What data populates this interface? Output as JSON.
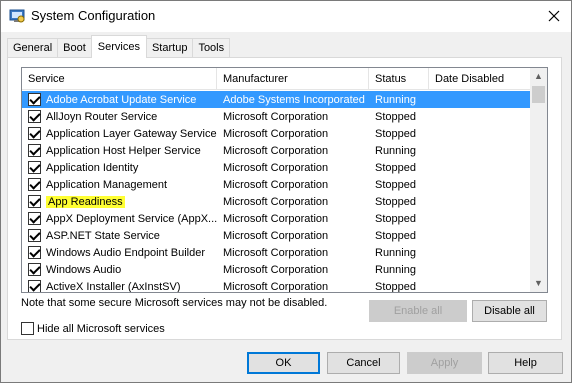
{
  "window": {
    "title": "System Configuration"
  },
  "tabs": [
    {
      "label": "General"
    },
    {
      "label": "Boot"
    },
    {
      "label": "Services"
    },
    {
      "label": "Startup"
    },
    {
      "label": "Tools"
    }
  ],
  "active_tab": "Services",
  "columns": {
    "service": "Service",
    "manufacturer": "Manufacturer",
    "status": "Status",
    "date_disabled": "Date Disabled"
  },
  "services": [
    {
      "name": "Adobe Acrobat Update Service",
      "manufacturer": "Adobe Systems Incorporated",
      "status": "Running",
      "date_disabled": "",
      "checked": true
    },
    {
      "name": "AllJoyn Router Service",
      "manufacturer": "Microsoft Corporation",
      "status": "Stopped",
      "date_disabled": "",
      "checked": true
    },
    {
      "name": "Application Layer Gateway Service",
      "manufacturer": "Microsoft Corporation",
      "status": "Stopped",
      "date_disabled": "",
      "checked": true
    },
    {
      "name": "Application Host Helper Service",
      "manufacturer": "Microsoft Corporation",
      "status": "Running",
      "date_disabled": "",
      "checked": true
    },
    {
      "name": "Application Identity",
      "manufacturer": "Microsoft Corporation",
      "status": "Stopped",
      "date_disabled": "",
      "checked": true
    },
    {
      "name": "Application Management",
      "manufacturer": "Microsoft Corporation",
      "status": "Stopped",
      "date_disabled": "",
      "checked": true
    },
    {
      "name": "App Readiness",
      "manufacturer": "Microsoft Corporation",
      "status": "Stopped",
      "date_disabled": "",
      "checked": true
    },
    {
      "name": "AppX Deployment Service (AppX...",
      "manufacturer": "Microsoft Corporation",
      "status": "Stopped",
      "date_disabled": "",
      "checked": true
    },
    {
      "name": "ASP.NET State Service",
      "manufacturer": "Microsoft Corporation",
      "status": "Stopped",
      "date_disabled": "",
      "checked": true
    },
    {
      "name": "Windows Audio Endpoint Builder",
      "manufacturer": "Microsoft Corporation",
      "status": "Running",
      "date_disabled": "",
      "checked": true
    },
    {
      "name": "Windows Audio",
      "manufacturer": "Microsoft Corporation",
      "status": "Running",
      "date_disabled": "",
      "checked": true
    },
    {
      "name": "ActiveX Installer (AxInstSV)",
      "manufacturer": "Microsoft Corporation",
      "status": "Stopped",
      "date_disabled": "",
      "checked": true
    }
  ],
  "selected_index": 0,
  "highlighted_index": 6,
  "note": "Note that some secure Microsoft services may not be disabled.",
  "buttons": {
    "enable_all": "Enable all",
    "disable_all": "Disable all",
    "ok": "OK",
    "cancel": "Cancel",
    "apply": "Apply",
    "help": "Help"
  },
  "hide_microsoft": {
    "label": "Hide all Microsoft services",
    "checked": false
  },
  "colors": {
    "selection": "#3399ff",
    "highlight": "#ffff33",
    "default_button_border": "#0078d7"
  },
  "icons": {
    "app": "system-configuration-icon",
    "close": "close-icon",
    "scroll_up": "chevron-up-icon",
    "scroll_down": "chevron-down-icon"
  }
}
